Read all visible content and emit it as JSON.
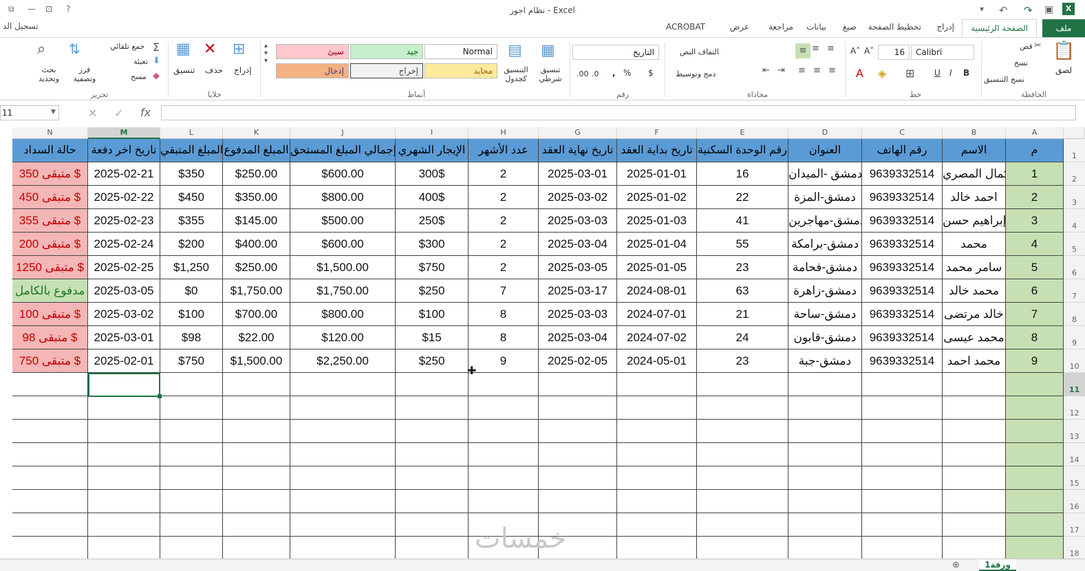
{
  "window": {
    "title": "نظام اجور - Excel",
    "signin": "تسجيل الد"
  },
  "tabs": [
    {
      "id": "file",
      "label": "ملف"
    },
    {
      "id": "home",
      "label": "الصفحة الرئيسية"
    },
    {
      "id": "insert",
      "label": "إدراج"
    },
    {
      "id": "layout",
      "label": "تخطيط الصفحة"
    },
    {
      "id": "formulas",
      "label": "صيغ"
    },
    {
      "id": "data",
      "label": "بيانات"
    },
    {
      "id": "review",
      "label": "مراجعة"
    },
    {
      "id": "view",
      "label": "عرض"
    },
    {
      "id": "acrobat",
      "label": "ACROBAT"
    }
  ],
  "ribbon": {
    "clipboard": {
      "group": "الحافظة",
      "paste": "لصق",
      "cut": "قص",
      "copy": "نسخ",
      "format_painter": "نسخ التنسيق"
    },
    "font": {
      "group": "خط",
      "name": "Calibri",
      "size": "16",
      "bold": "B",
      "italic": "I",
      "underline": "U"
    },
    "alignment": {
      "group": "محاذاة",
      "wrap": "التفاف النص",
      "merge": "دمج وتوسيط"
    },
    "number": {
      "group": "رقم",
      "format": "التاريخ",
      "currency": "$",
      "percent": "%",
      "comma": ","
    },
    "styles": {
      "group": "أنماط",
      "conditional": "تنسيق شرطي",
      "as_table": "التنسيق كجدول",
      "normal": "Normal",
      "good": "جيد",
      "bad": "سيئ",
      "neutral": "محايد",
      "output": "إخراج",
      "input": "إدخال"
    },
    "cells": {
      "group": "خلايا",
      "insert": "إدراج",
      "delete": "حذف",
      "format": "تنسيق"
    },
    "editing": {
      "group": "تحرير",
      "autosum": "جمع تلقائي",
      "fill": "تعبئة",
      "clear": "مسح",
      "sort": "فرز وتصفية",
      "find": "بحث وتحديد"
    }
  },
  "formula_bar": {
    "name_box": "11",
    "fx": "fx",
    "value": ""
  },
  "columns": [
    "A",
    "B",
    "C",
    "D",
    "E",
    "F",
    "G",
    "H",
    "I",
    "J",
    "K",
    "L",
    "M",
    "N"
  ],
  "selected_column": "M",
  "selected_row": "11",
  "header_row": [
    "م",
    "الاسم",
    "رقم الهاتف",
    "العنوان",
    "رقم الوحدة السكنية",
    "تاريخ بداية العقد",
    "تاريخ نهاية العقد",
    "عدد الأشهر",
    "الإيجار الشهري",
    "إجمالي المبلغ المستحق",
    "المبلغ المدفوع",
    "المبلغ المتبقي",
    "تاريخ اخر دفعة",
    "حالة السداد"
  ],
  "rows": [
    {
      "m": "1",
      "name": "كمال المصري",
      "phone": "9639332514",
      "addr": "دمشق -الميدان",
      "unit": "16",
      "start": "2025-01-01",
      "end": "2025-03-01",
      "months": "2",
      "rent": "300$",
      "total": "$600.00",
      "paid": "$250.00",
      "rem": "$350",
      "last": "2025-02-21",
      "status": "متبقى 350 $",
      "st": "owed"
    },
    {
      "m": "2",
      "name": "احمد خالد",
      "phone": "9639332514",
      "addr": "دمشق-المزة",
      "unit": "22",
      "start": "2025-01-02",
      "end": "2025-03-02",
      "months": "2",
      "rent": "400$",
      "total": "$800.00",
      "paid": "$350.00",
      "rem": "$450",
      "last": "2025-02-22",
      "status": "متبقى 450 $",
      "st": "owed"
    },
    {
      "m": "3",
      "name": "إبراهيم حسن",
      "phone": "9639332514",
      "addr": "دمشق-مهاجرين",
      "unit": "41",
      "start": "2025-01-03",
      "end": "2025-03-03",
      "months": "2",
      "rent": "250$",
      "total": "$500.00",
      "paid": "$145.00",
      "rem": "$355",
      "last": "2025-02-23",
      "status": "متبقى 355 $",
      "st": "owed"
    },
    {
      "m": "4",
      "name": "محمد",
      "phone": "9639332514",
      "addr": "دمشق-برامكة",
      "unit": "55",
      "start": "2025-01-04",
      "end": "2025-03-04",
      "months": "2",
      "rent": "$300",
      "total": "$600.00",
      "paid": "$400.00",
      "rem": "$200",
      "last": "2025-02-24",
      "status": "متبقى 200 $",
      "st": "owed"
    },
    {
      "m": "5",
      "name": "سامر محمد",
      "phone": "9639332514",
      "addr": "دمشق-فحامة",
      "unit": "23",
      "start": "2025-01-05",
      "end": "2025-03-05",
      "months": "2",
      "rent": "$750",
      "total": "$1,500.00",
      "paid": "$250.00",
      "rem": "$1,250",
      "last": "2025-02-25",
      "status": "متبقى 1250 $",
      "st": "owed"
    },
    {
      "m": "6",
      "name": "محمد خالد",
      "phone": "9639332514",
      "addr": "دمشق-زاهرة",
      "unit": "63",
      "start": "2024-08-01",
      "end": "2025-03-17",
      "months": "7",
      "rent": "$250",
      "total": "$1,750.00",
      "paid": "$1,750.00",
      "rem": "$0",
      "last": "2025-03-05",
      "status": "مدفوع بالكامل",
      "st": "paid"
    },
    {
      "m": "7",
      "name": "خالد مرتضى",
      "phone": "9639332514",
      "addr": "دمشق-ساحة",
      "unit": "21",
      "start": "2024-07-01",
      "end": "2025-03-03",
      "months": "8",
      "rent": "$100",
      "total": "$800.00",
      "paid": "$700.00",
      "rem": "$100",
      "last": "2025-03-02",
      "status": "متبقى 100 $",
      "st": "owed"
    },
    {
      "m": "8",
      "name": "محمد عيسى",
      "phone": "9639332514",
      "addr": "دمشق-قابون",
      "unit": "24",
      "start": "2024-07-02",
      "end": "2025-03-04",
      "months": "8",
      "rent": "$15",
      "total": "$120.00",
      "paid": "$22.00",
      "rem": "$98",
      "last": "2025-03-01",
      "status": "متبقى 98 $",
      "st": "owed"
    },
    {
      "m": "9",
      "name": "محمد احمد",
      "phone": "9639332514",
      "addr": "دمشق-جبة",
      "unit": "23",
      "start": "2024-05-01",
      "end": "2025-02-05",
      "months": "9",
      "rent": "$250",
      "total": "$2,250.00",
      "paid": "$1,500.00",
      "rem": "$750",
      "last": "2025-02-01",
      "status": "متبقى 750 $",
      "st": "owed"
    }
  ],
  "row_numbers": [
    "1",
    "2",
    "3",
    "4",
    "5",
    "6",
    "7",
    "8",
    "9",
    "10",
    "11",
    "12",
    "13",
    "14",
    "15",
    "16",
    "17",
    "18"
  ],
  "sheet_tab": "ورقة1",
  "watermark": "خمسات",
  "colors": {
    "accent": "#217346",
    "header_fill": "#5b9bd5",
    "owed_fill": "#f4b6b6",
    "owed_text": "#c00000",
    "paid_fill": "#c6e0b4",
    "index_fill": "#c6e0b4"
  }
}
